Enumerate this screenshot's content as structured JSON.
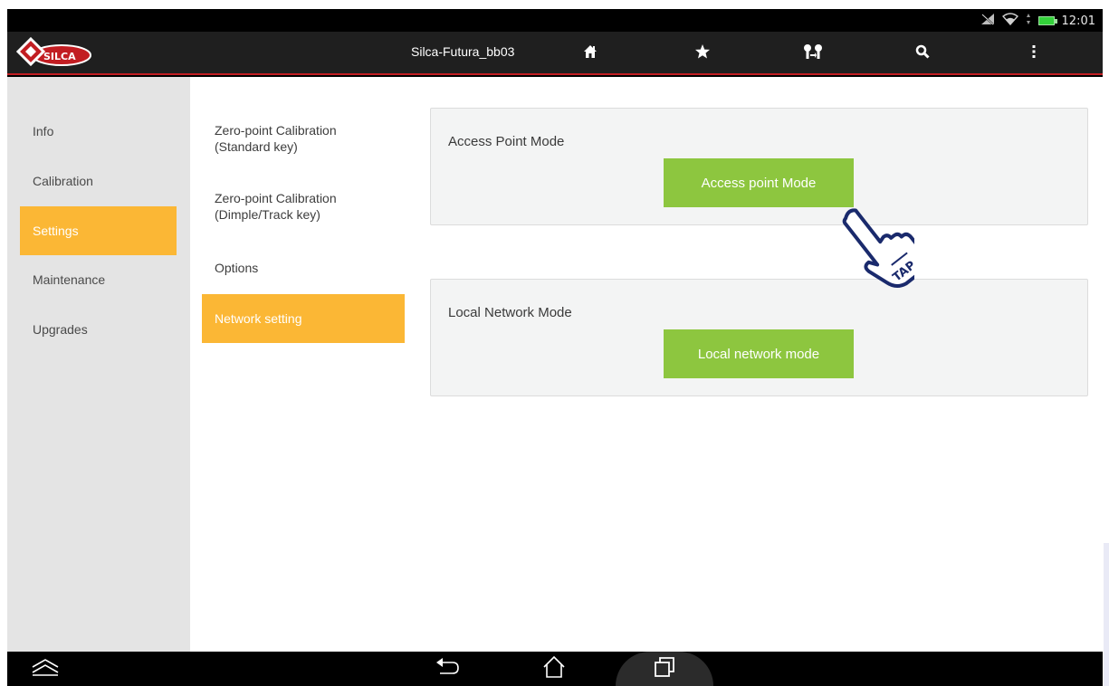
{
  "status_bar": {
    "time": "12:01",
    "icons": [
      "no-signal-icon",
      "wifi-icon",
      "data-arrows-icon",
      "battery-icon"
    ],
    "battery_color": "#33d23a"
  },
  "app_bar": {
    "logo_text": "SILCA",
    "device_name": "Silca-Futura_bb03",
    "actions": [
      "home-icon",
      "star-icon",
      "key-transfer-icon",
      "search-icon",
      "overflow-menu-icon"
    ],
    "accent_color": "#c21d22"
  },
  "sidebar": {
    "items": [
      {
        "label": "Info",
        "active": false
      },
      {
        "label": "Calibration",
        "active": false
      },
      {
        "label": "Settings",
        "active": true
      },
      {
        "label": "Maintenance",
        "active": false
      },
      {
        "label": "Upgrades",
        "active": false
      }
    ],
    "active_color": "#fbb735"
  },
  "submenu": {
    "items": [
      {
        "label": "Zero-point Calibration\n(Standard key)",
        "active": false
      },
      {
        "label": "Zero-point Calibration\n(Dimple/Track key)",
        "active": false
      },
      {
        "label": "Options",
        "active": false
      },
      {
        "label": "Network setting",
        "active": true
      }
    ]
  },
  "main": {
    "access_point": {
      "title": "Access Point Mode",
      "button_label": "Access point Mode"
    },
    "local_network": {
      "title": "Local Network Mode",
      "button_label": "Local network mode"
    },
    "button_color": "#8dc63f"
  },
  "overlay": {
    "tap_label": "TAP"
  },
  "nav_bar": {
    "buttons": [
      "expand-icon",
      "back-icon",
      "home-outline-icon",
      "recents-icon"
    ]
  }
}
